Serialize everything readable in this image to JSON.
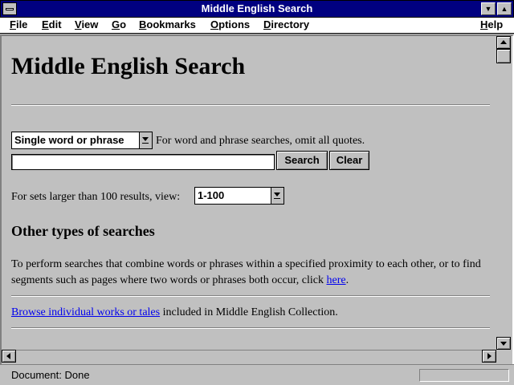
{
  "window": {
    "title": "Middle English Search"
  },
  "menu": [
    {
      "accel": "F",
      "rest": "ile"
    },
    {
      "accel": "E",
      "rest": "dit"
    },
    {
      "accel": "V",
      "rest": "iew"
    },
    {
      "accel": "G",
      "rest": "o"
    },
    {
      "accel": "B",
      "rest": "ookmarks"
    },
    {
      "accel": "O",
      "rest": "ptions"
    },
    {
      "accel": "D",
      "rest": "irectory"
    },
    {
      "accel": "H",
      "rest": "elp"
    }
  ],
  "page": {
    "title": "Middle English Search",
    "search_type": "Single word or phrase",
    "search_hint": "For word and phrase searches, omit all quotes.",
    "search_value": "",
    "search_button": "Search",
    "clear_button": "Clear",
    "results_label": "For sets larger than 100 results, view:",
    "results_range": "1-100",
    "other_heading": "Other types of searches",
    "proximity_text": "To perform searches that combine words or phrases within a specified proximity to each other, or to find segments such as pages where two words or phrases both occur, click",
    "proximity_link": "here",
    "proximity_end": ".",
    "browse_link": "Browse individual works or tales",
    "browse_rest": " included in Middle English Collection."
  },
  "status": {
    "text": "Document: Done"
  },
  "colors": {
    "titlebar": "#000080",
    "chrome": "#c0c0c0",
    "link": "#0000ee"
  },
  "icons": [
    "system-menu-icon",
    "minimize-icon",
    "maximize-icon",
    "dropdown-arrow-icon",
    "scroll-up-icon",
    "scroll-down-icon",
    "scroll-left-icon",
    "scroll-right-icon"
  ]
}
